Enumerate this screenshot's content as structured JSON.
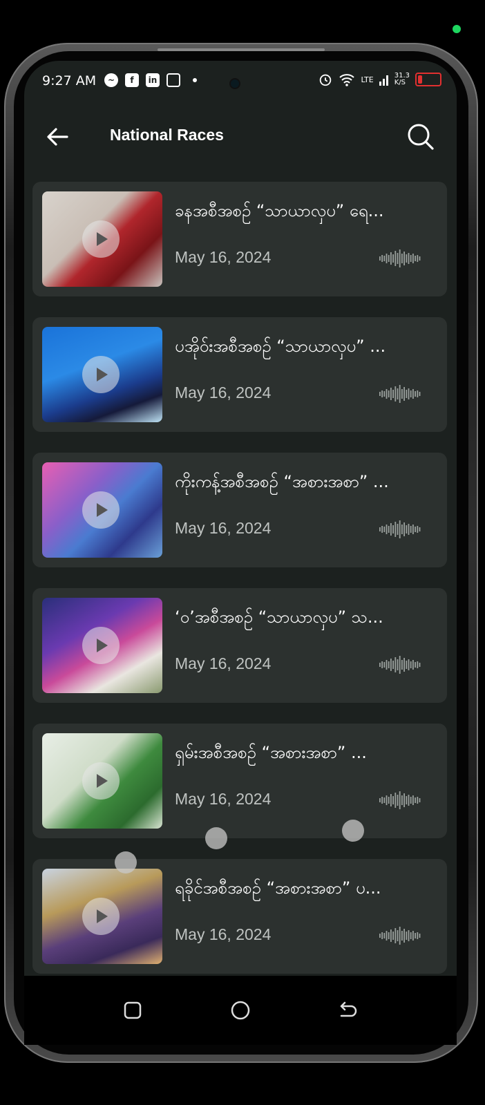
{
  "status_bar": {
    "time": "9:27 AM",
    "app_icons": [
      "messenger-icon",
      "facebook-icon",
      "linkedin-icon",
      "instagram-icon"
    ],
    "network": "LTE",
    "speed": "31.3",
    "speed_unit": "K/S"
  },
  "appbar": {
    "title": "National Races"
  },
  "items": [
    {
      "title": "ခနအစီအစဉ် “သာယာလှပ” ရေ...",
      "date": "May 16, 2024"
    },
    {
      "title": "ပအိုဝ်းအစီအစဉ် “သာယာလှပ” ...",
      "date": "May 16, 2024"
    },
    {
      "title": "ကိုးကန့်အစီအစဉ် “အစားအစာ” ...",
      "date": "May 16, 2024"
    },
    {
      "title": "‘ဝ’အစီအစဉ် “သာယာလှပ” သ...",
      "date": "May 16, 2024"
    },
    {
      "title": "ရှမ်းအစီအစဉ် “အစားအစာ” ...",
      "date": "May 16, 2024"
    },
    {
      "title": "ရခိုင်အစီအစဉ် “အစားအစာ” ပ...",
      "date": "May 16, 2024"
    }
  ],
  "colors": {
    "background": "#1c211f",
    "card": "#2c312f",
    "accent_battery": "#e23030"
  }
}
